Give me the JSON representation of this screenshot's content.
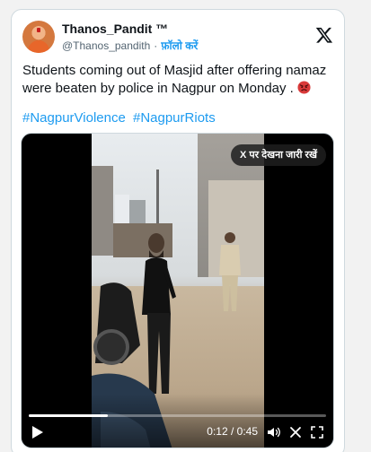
{
  "author": {
    "name": "Thanos_Pandit ™",
    "handle": "@Thanos_pandith",
    "separator": "·",
    "follow_label": "फ़ॉलो करें"
  },
  "tweet": {
    "text": "Students coming out of Masjid after offering namaz were beaten by police in Nagpur on Monday .",
    "emoji": "angry-face-emoji",
    "hashtags": [
      "#NagpurViolence",
      "#NagpurRiots"
    ]
  },
  "video": {
    "keep_watching_label": "X पर देखना जारी रखें",
    "time": "0:12 / 0:45",
    "progress": 0.267
  },
  "icons": {
    "logo": "x-logo-icon",
    "play": "play-icon",
    "volume": "volume-icon",
    "fullscreen": "fullscreen-icon",
    "close": "close-icon"
  },
  "colors": {
    "link": "#1d9bf0",
    "text": "#0f1419",
    "muted": "#536471"
  }
}
